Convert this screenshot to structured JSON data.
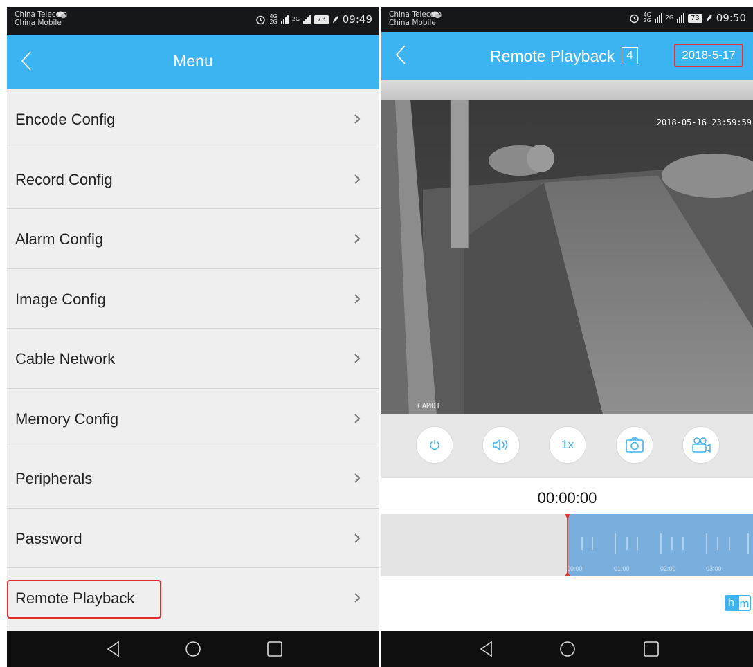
{
  "left_screen": {
    "status_bar": {
      "carrier_1": "China Telecom",
      "carrier_2": "China Mobile",
      "net_label": "4G",
      "net_label_2": "2G",
      "sim2_label": "2G",
      "battery": "73",
      "time": "09:49"
    },
    "header": {
      "title": "Menu"
    },
    "menu_items": [
      {
        "label": "Encode Config"
      },
      {
        "label": "Record Config"
      },
      {
        "label": "Alarm Config"
      },
      {
        "label": "Image Config"
      },
      {
        "label": "Cable Network"
      },
      {
        "label": "Memory Config"
      },
      {
        "label": "Peripherals"
      },
      {
        "label": "Password"
      },
      {
        "label": "Remote Playback"
      }
    ]
  },
  "right_screen": {
    "status_bar": {
      "carrier_1": "China Telecom",
      "carrier_2": "China Mobile",
      "net_label": "4G",
      "net_label_2": "2G",
      "sim2_label": "2G",
      "battery": "73",
      "time": "09:50"
    },
    "header": {
      "title": "Remote Playback",
      "channel_count": "4",
      "date": "2018-5-17"
    },
    "video": {
      "timestamp": "2018-05-16 23:59:59",
      "camera_label": "CAM01"
    },
    "controls": {
      "speed_label": "1x"
    },
    "playback_time": "00:00:00",
    "timeline": {
      "tick_labels": [
        "00:00",
        "01:00",
        "02:00",
        "03:00"
      ]
    },
    "logo": {
      "letter_1": "h",
      "letter_2": "m"
    }
  },
  "colors": {
    "accent": "#3db4f2",
    "highlight_red": "#df2c2c",
    "timeline_blue": "#7aaedd",
    "status_bar": "#15171b"
  },
  "icons": [
    "back-chevron-icon",
    "chevron-right-icon",
    "power-icon",
    "speaker-icon",
    "camera-icon",
    "video-record-icon",
    "nav-back-icon",
    "nav-home-icon",
    "nav-recents-icon",
    "alarm-icon",
    "wechat-icon"
  ]
}
